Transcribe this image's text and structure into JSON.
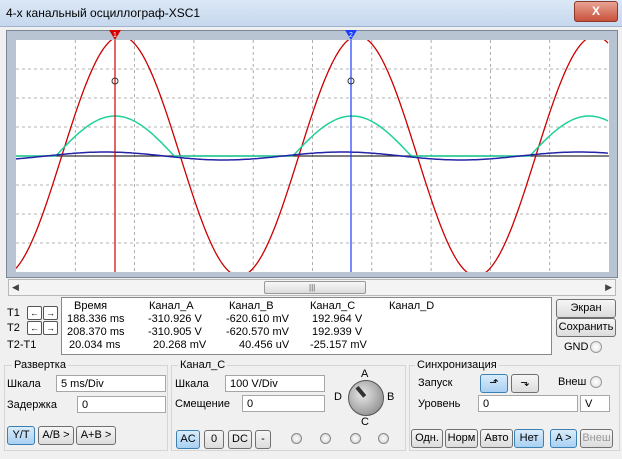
{
  "window": {
    "title": "4-х канальный осциллограф-XSC1",
    "close_label": "X"
  },
  "cursors": {
    "t1_label": "1",
    "t2_label": "2"
  },
  "colors": {
    "channel_a": "#cc0000",
    "channel_b": "#20d09a",
    "channel_c": "#2424a8",
    "cursor_t1": "#d40000",
    "cursor_t2": "#1a3cff",
    "grid": "#9a9a9a"
  },
  "readout": {
    "headers": [
      "Время",
      "Канал_A",
      "Канал_B",
      "Канал_C",
      "Канал_D"
    ],
    "rows": [
      {
        "label": "T1",
        "values": [
          "188.336 ms",
          "-310.926 V",
          "-620.610 mV",
          "192.964 V",
          ""
        ]
      },
      {
        "label": "T2",
        "values": [
          "208.370 ms",
          "-310.905 V",
          "-620.570 mV",
          "192.939 V",
          ""
        ]
      },
      {
        "label": "T2-T1",
        "values": [
          "20.034 ms",
          "20.268 mV",
          "40.456 uV",
          "-25.157 mV",
          ""
        ]
      }
    ]
  },
  "side": {
    "screen_label": "Экран",
    "save_label": "Сохранить",
    "gnd_label": "GND"
  },
  "timebase": {
    "title": "Развертка",
    "scale_label": "Шкала",
    "scale_value": "5 ms/Div",
    "delay_label": "Задержка",
    "delay_value": "0",
    "yt_label": "Y/T",
    "ab_label": "A/B >",
    "apb_label": "A+B >"
  },
  "channel": {
    "title": "Канал_C",
    "scale_label": "Шкала",
    "scale_value": "100  V/Div",
    "offset_label": "Смещение",
    "offset_value": "0",
    "ac_label": "AC",
    "zero_label": "0",
    "dc_label": "DC",
    "minus_label": "-"
  },
  "selector": {
    "a": "A",
    "b": "B",
    "c": "C",
    "d": "D"
  },
  "trigger": {
    "title": "Синхронизация",
    "start_label": "Запуск",
    "ext_label": "Внеш",
    "level_label": "Уровень",
    "level_value": "0",
    "level_unit": "V",
    "single_label": "Одн.",
    "norm_label": "Норм",
    "auto_label": "Авто",
    "none_label": "Нет",
    "a_label": "A >",
    "ext2_label": "Внеш"
  }
}
